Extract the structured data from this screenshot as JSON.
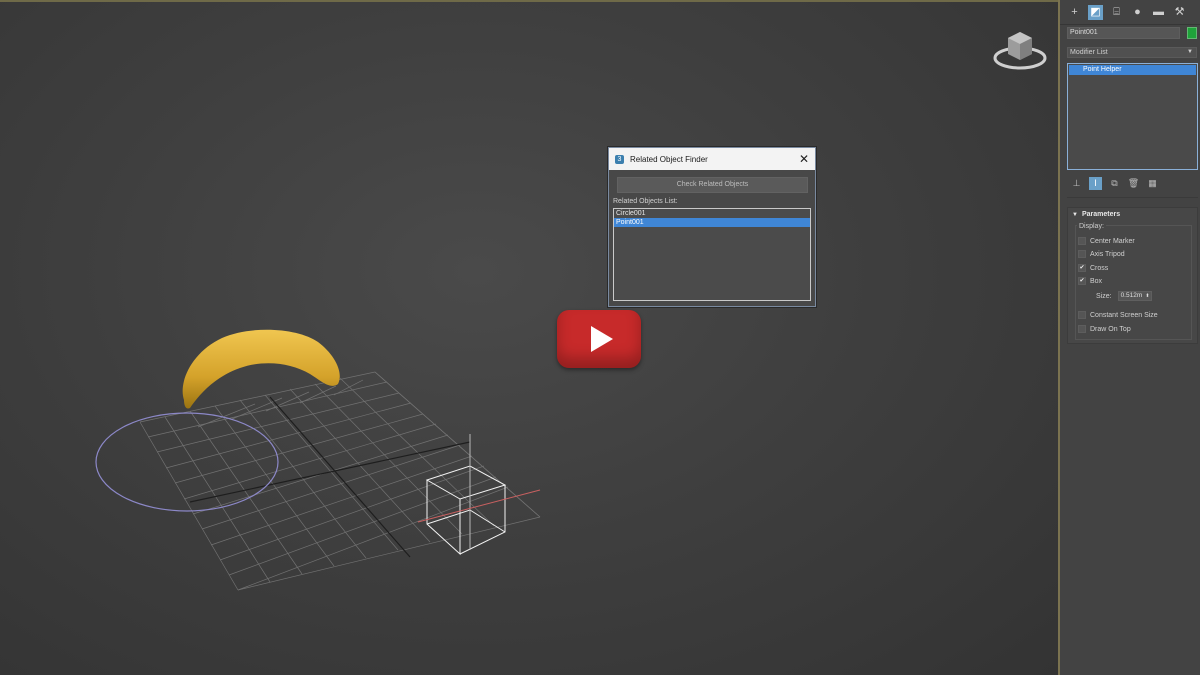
{
  "dialog": {
    "title": "Related Object Finder",
    "close_glyph": "✕",
    "check_button": "Check Related Objects",
    "list_label": "Related Objects List:",
    "items": [
      "Circle001",
      "Point001"
    ],
    "selected_index": 1
  },
  "command_panel": {
    "tabs": [
      {
        "icon": "plus-icon",
        "glyph": "+"
      },
      {
        "icon": "modify-icon",
        "glyph": "◩"
      },
      {
        "icon": "hierarchy-icon",
        "glyph": "⌸"
      },
      {
        "icon": "motion-icon",
        "glyph": "●"
      },
      {
        "icon": "display-icon",
        "glyph": "▬"
      },
      {
        "icon": "utilities-icon",
        "glyph": "⚒"
      }
    ],
    "object_name": "Point001",
    "color_swatch": "#1fa33a",
    "modifier_list": "Modifier List",
    "stack_items": [
      "Point Helper"
    ],
    "stack_tools": [
      {
        "icon": "pin-stack-icon",
        "glyph": "⊥"
      },
      {
        "icon": "show-end-result-icon",
        "glyph": "I"
      },
      {
        "icon": "make-unique-icon",
        "glyph": "⧉"
      },
      {
        "icon": "remove-modifier-icon",
        "glyph": "🗑"
      },
      {
        "icon": "configure-sets-icon",
        "glyph": "▦"
      }
    ],
    "parameters": {
      "title": "Parameters",
      "display_label": "Display:",
      "options": [
        {
          "label": "Center Marker",
          "checked": false
        },
        {
          "label": "Axis Tripod",
          "checked": false
        },
        {
          "label": "Cross",
          "checked": true
        },
        {
          "label": "Box",
          "checked": true
        }
      ],
      "size_label": "Size:",
      "size_value": "0.512m",
      "extra_options": [
        {
          "label": "Constant Screen Size",
          "checked": false
        },
        {
          "label": "Draw On Top",
          "checked": false
        }
      ]
    }
  },
  "colors": {
    "selection": "#3f86d6",
    "banana": "#d8a82a",
    "circle": "#8c88c8",
    "play": "#c72a2a"
  }
}
